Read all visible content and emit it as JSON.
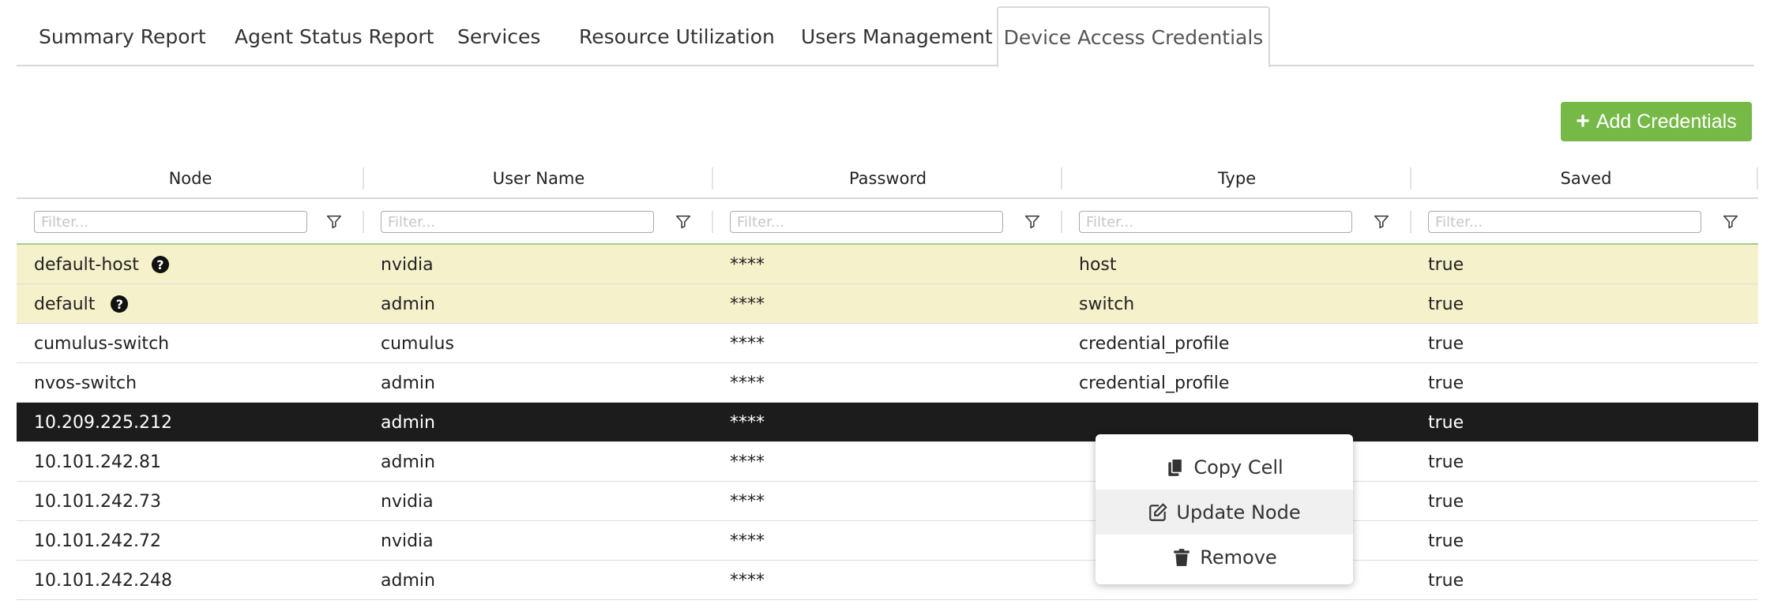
{
  "tabs": [
    {
      "label": "Summary Report"
    },
    {
      "label": "Agent Status Report"
    },
    {
      "label": "Services"
    },
    {
      "label": "Resource Utilization"
    },
    {
      "label": "Users Management"
    },
    {
      "label": "Device Access Credentials",
      "active": true
    }
  ],
  "toolbar": {
    "add_label": "Add Credentials"
  },
  "table": {
    "columns": [
      "Node",
      "User Name",
      "Password",
      "Type",
      "Saved"
    ],
    "filter_placeholder": "Filter...",
    "rows": [
      {
        "node": "default-host",
        "user": "nvidia",
        "password": "****",
        "type": "host",
        "saved": "true"
      },
      {
        "node": "default",
        "user": "admin",
        "password": "****",
        "type": "switch",
        "saved": "true"
      },
      {
        "node": "cumulus-switch",
        "user": "cumulus",
        "password": "****",
        "type": "credential_profile",
        "saved": "true"
      },
      {
        "node": "nvos-switch",
        "user": "admin",
        "password": "****",
        "type": "credential_profile",
        "saved": "true"
      },
      {
        "node": "10.209.225.212",
        "user": "admin",
        "password": "****",
        "type": "",
        "saved": "true"
      },
      {
        "node": "10.101.242.81",
        "user": "admin",
        "password": "****",
        "type": "",
        "saved": "true"
      },
      {
        "node": "10.101.242.73",
        "user": "nvidia",
        "password": "****",
        "type": "",
        "saved": "true"
      },
      {
        "node": "10.101.242.72",
        "user": "nvidia",
        "password": "****",
        "type": "",
        "saved": "true"
      },
      {
        "node": "10.101.242.248",
        "user": "admin",
        "password": "****",
        "type": "",
        "saved": "true"
      }
    ]
  },
  "context_menu": {
    "copy_label": "Copy Cell",
    "update_label": "Update Node",
    "remove_label": "Remove"
  },
  "colors": {
    "accent_green": "#76b947",
    "default_row": "#f5f1cb",
    "selected_row": "#1c1c1c"
  },
  "icons": {
    "help": "?"
  }
}
